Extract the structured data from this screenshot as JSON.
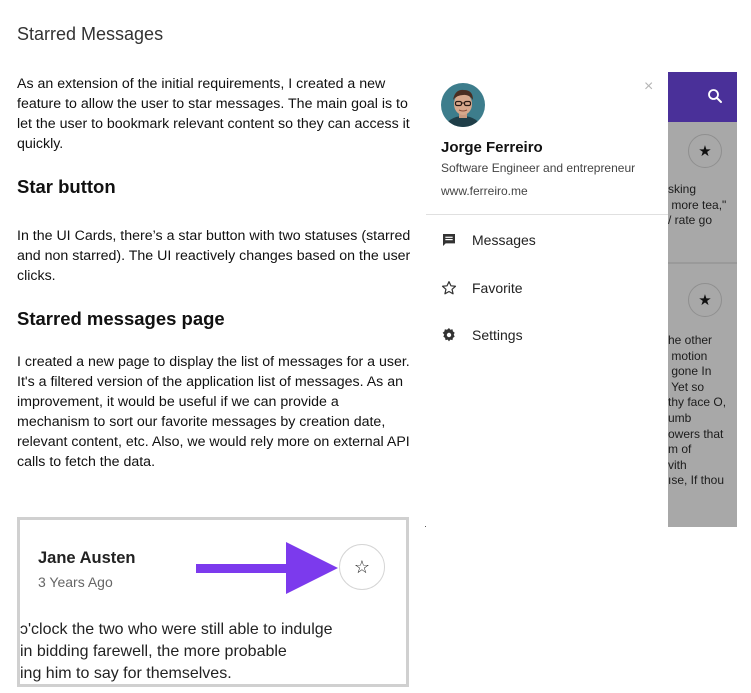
{
  "document": {
    "title": "Starred Messages",
    "intro": "As an extension of the initial requirements, I created a new feature to allow the user to star messages. The main goal is to let the user to bookmark relevant content so they can access it quickly.",
    "sections": [
      {
        "heading": "Star button",
        "body": "In the UI Cards, there’s a star button with two statuses (starred and non starred). The UI reactively changes based on the user clicks."
      },
      {
        "heading": "Starred messages page",
        "body": "I created a new page to display the list of messages for a user. It's a filtered version of the application list of messages. As an improvement, it would be useful if we can provide a mechanism to sort our favorite messages by creation date, relevant content, etc. Also, we would rely more on external API calls to fetch the data."
      }
    ]
  },
  "drawer": {
    "close_label": "×",
    "profile": {
      "name": "Jorge Ferreiro",
      "role": "Software Engineer and entrepreneur",
      "website": "www.ferreiro.me"
    },
    "nav": [
      {
        "label": "Messages",
        "icon": "message-icon"
      },
      {
        "label": "Favorite",
        "icon": "star-outline-icon"
      },
      {
        "label": "Settings",
        "icon": "gear-icon"
      }
    ]
  },
  "background_app": {
    "header_color": "#4a3099",
    "card1_text": "sking\n more tea,\"\n/ rate go",
    "card2_text": "he other\n motion\n gone In\n Yet so\nthy face O,\numb\nowers that\nm of\nvith\nıse, If thou",
    "star_glyph": "★"
  },
  "screenshot_card": {
    "author": "Jane Austen",
    "time": "3 Years Ago",
    "star_glyph": "☆",
    "lines": [
      "ɔ'clock the two who were still able to indulge",
      "in bidding farewell, the more probable",
      "ing him to say for themselves."
    ],
    "arrow_color": "#7c3aed"
  }
}
